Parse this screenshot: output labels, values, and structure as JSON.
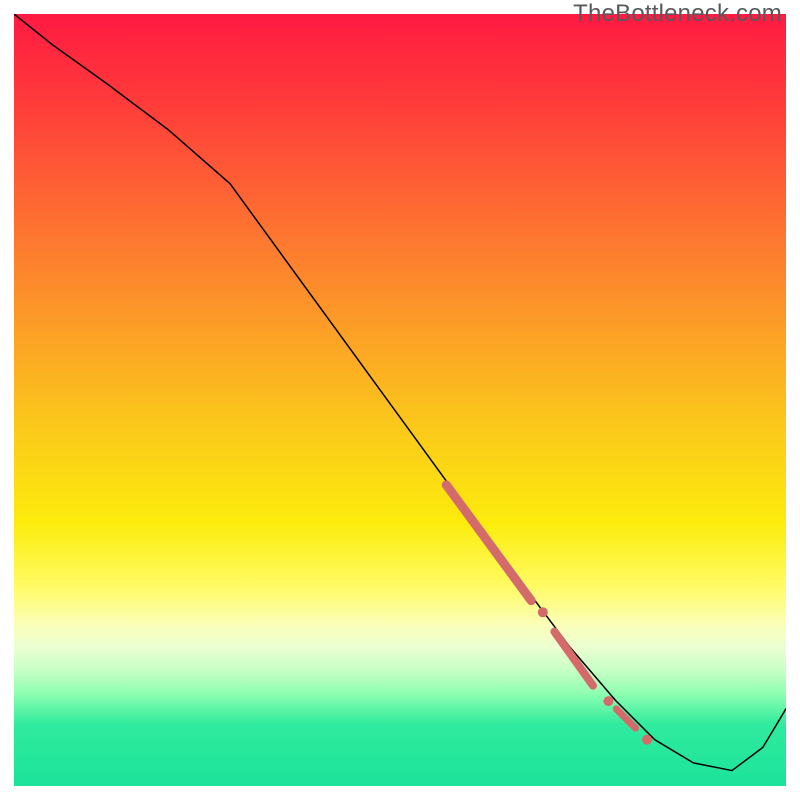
{
  "watermark": "TheBottleneck.com",
  "chart_data": {
    "type": "line",
    "title": "",
    "xlabel": "",
    "ylabel": "",
    "xlim": [
      0,
      100
    ],
    "ylim": [
      0,
      100
    ],
    "grid": false,
    "legend": false,
    "series": [
      {
        "name": "bottleneck-curve",
        "color": "#000000",
        "width": 1.5,
        "x": [
          0,
          5,
          12,
          20,
          28,
          36,
          44,
          52,
          60,
          66,
          72,
          78,
          83,
          88,
          93,
          97,
          100
        ],
        "values": [
          100,
          96,
          91,
          85,
          78,
          67,
          56,
          45,
          34,
          26,
          18,
          11,
          6,
          3,
          2,
          5,
          10
        ]
      },
      {
        "name": "highlight-thick",
        "color": "#d46a6a",
        "type": "segment",
        "width": 9,
        "x": [
          56,
          67
        ],
        "values": [
          39,
          24
        ]
      },
      {
        "name": "highlight-gap-dot-1",
        "color": "#d46a6a",
        "type": "point",
        "r": 5,
        "x": [
          68.5
        ],
        "values": [
          22.5
        ]
      },
      {
        "name": "highlight-seg-2",
        "color": "#d46a6a",
        "type": "segment",
        "width": 8,
        "x": [
          70,
          75
        ],
        "values": [
          20,
          13
        ]
      },
      {
        "name": "highlight-gap-dot-2",
        "color": "#d46a6a",
        "type": "point",
        "r": 5,
        "x": [
          77
        ],
        "values": [
          11
        ]
      },
      {
        "name": "highlight-seg-3",
        "color": "#d46a6a",
        "type": "segment",
        "width": 7,
        "x": [
          78,
          80.5
        ],
        "values": [
          10,
          7.5
        ]
      },
      {
        "name": "highlight-end-dot",
        "color": "#d46a6a",
        "type": "point",
        "r": 5,
        "x": [
          82
        ],
        "values": [
          6
        ]
      }
    ]
  }
}
